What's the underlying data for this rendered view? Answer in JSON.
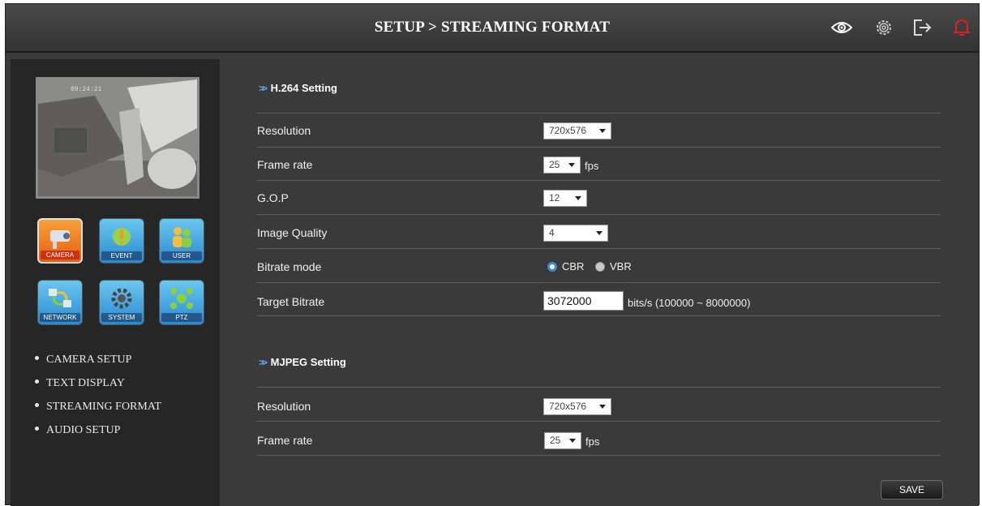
{
  "header": {
    "title": "SETUP > STREAMING FORMAT",
    "icons": [
      "eye-icon",
      "gear-icon",
      "logout-icon",
      "alarm-bell-icon"
    ]
  },
  "sidebar": {
    "preview_timestamp": "09:24:21",
    "menu_icons": [
      {
        "label": "CAMERA",
        "icon": "camera-icon"
      },
      {
        "label": "EVENT",
        "icon": "event-icon"
      },
      {
        "label": "USER",
        "icon": "user-icon"
      },
      {
        "label": "NETWORK",
        "icon": "network-icon"
      },
      {
        "label": "SYSTEM",
        "icon": "system-gear-icon"
      },
      {
        "label": "PTZ",
        "icon": "ptz-icon"
      }
    ],
    "submenu": [
      "CAMERA SETUP",
      "TEXT DISPLAY",
      "STREAMING FORMAT",
      "AUDIO SETUP"
    ]
  },
  "h264": {
    "title": "H.264 Setting",
    "resolution": {
      "label": "Resolution",
      "value": "720x576"
    },
    "frame_rate": {
      "label": "Frame rate",
      "value": "25",
      "unit": "fps"
    },
    "gop": {
      "label": "G.O.P",
      "value": "12"
    },
    "image_quality": {
      "label": "Image Quality",
      "value": "4"
    },
    "bitrate_mode": {
      "label": "Bitrate mode",
      "options": [
        "CBR",
        "VBR"
      ],
      "selected": "CBR"
    },
    "target_bitrate": {
      "label": "Target Bitrate",
      "value": "3072000",
      "unit": "bits/s (100000 ~ 8000000)"
    }
  },
  "mjpeg": {
    "title": "MJPEG Setting",
    "resolution": {
      "label": "Resolution",
      "value": "720x576"
    },
    "frame_rate": {
      "label": "Frame rate",
      "value": "25",
      "unit": "fps"
    }
  },
  "save_label": "SAVE"
}
